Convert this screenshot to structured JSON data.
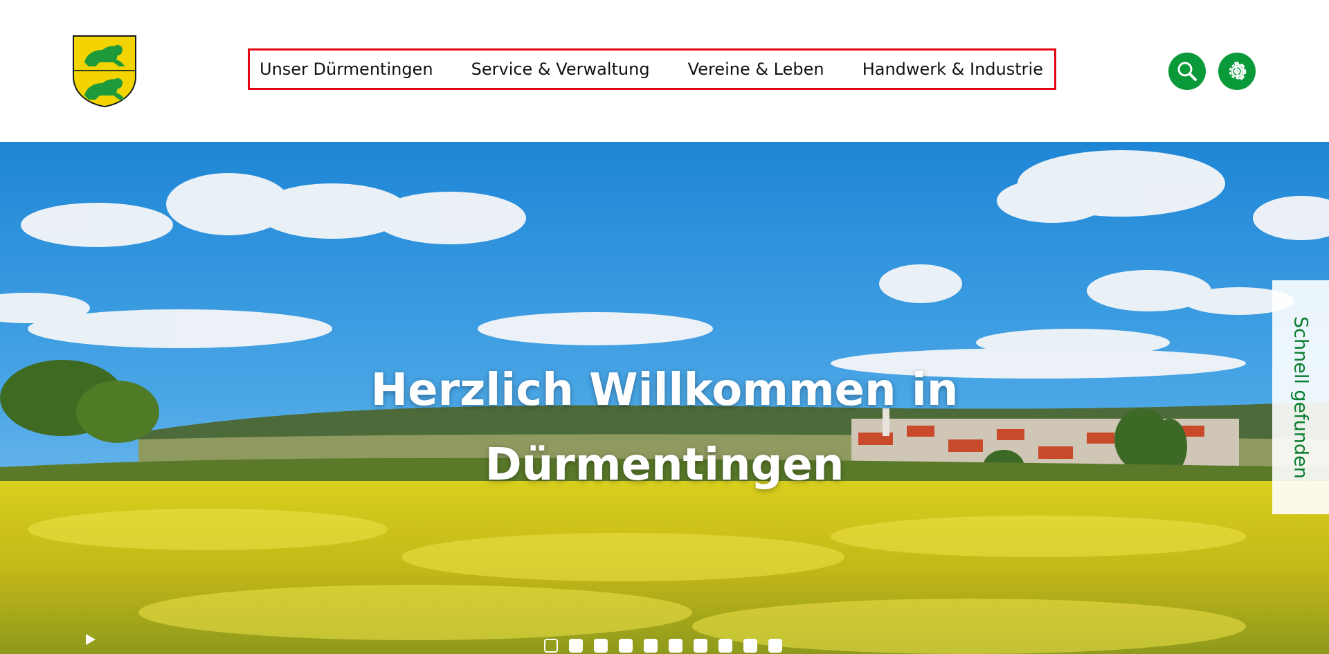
{
  "header": {
    "logo_icon": "coat-of-arms-lions",
    "nav": [
      {
        "label": "Unser Dürmentingen"
      },
      {
        "label": "Service & Verwaltung"
      },
      {
        "label": "Vereine & Leben"
      },
      {
        "label": "Handwerk & Industrie"
      }
    ],
    "search_icon": "search-icon",
    "settings_icon": "gear-icon",
    "accent_color": "#0a9a3a",
    "highlight_color": "#e30613"
  },
  "hero": {
    "title_line1": "Herzlich Willkommen in",
    "title_line2": "Dürmentingen",
    "side_tab_label": "Schnell gefunden",
    "play_icon": "play-icon",
    "slide_count": 10,
    "active_slide": 1
  }
}
